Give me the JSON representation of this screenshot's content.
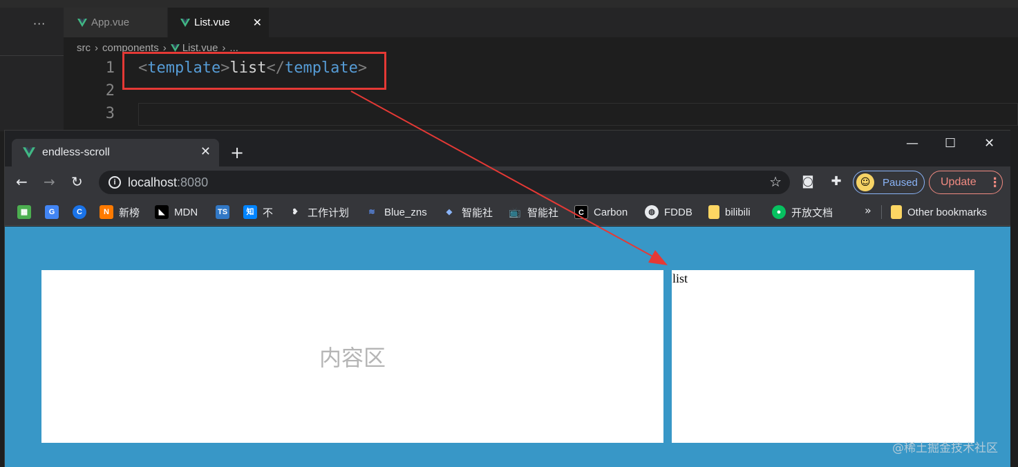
{
  "editor": {
    "more_icon": "ellipsis-icon",
    "tabs": [
      {
        "label": "App.vue",
        "icon": "vue-logo-icon",
        "active": false
      },
      {
        "label": "List.vue",
        "icon": "vue-logo-icon",
        "active": true
      }
    ],
    "close_glyph": "✕",
    "breadcrumb": [
      "src",
      "components",
      "List.vue",
      "..."
    ],
    "line_numbers": [
      "1",
      "2",
      "3"
    ],
    "code": {
      "open_lt": "<",
      "open_tag": "template",
      "open_gt": ">",
      "text": "list",
      "close_lt": "</",
      "close_tag": "template",
      "close_gt": ">"
    },
    "highlight_color": "#e53935"
  },
  "browser": {
    "tab_title": "endless-scroll",
    "tab_close": "✕",
    "new_tab": "+",
    "window_controls": {
      "minimize": "—",
      "maximize": "☐",
      "close": "✕"
    },
    "url_host": "localhost",
    "url_port": ":8080",
    "profile_label": "Paused",
    "update_label": "Update",
    "bookmarks": [
      {
        "label": "",
        "icon": "apps-grid-icon"
      },
      {
        "label": "",
        "icon": "google-translate-icon"
      },
      {
        "label": "",
        "icon": "c-logo-icon"
      },
      {
        "label": "新榜",
        "icon": "newrank-icon"
      },
      {
        "label": "MDN",
        "icon": "mdn-icon"
      },
      {
        "label": "",
        "icon": "typescript-icon"
      },
      {
        "label": "不",
        "icon": "zhihu-icon"
      },
      {
        "label": "工作计划",
        "icon": "feather-icon"
      },
      {
        "label": "Blue_zns",
        "icon": "layers-icon"
      },
      {
        "label": "智能社",
        "icon": "diamond-icon"
      },
      {
        "label": "智能社",
        "icon": "bilibili-tv-icon"
      },
      {
        "label": "Carbon",
        "icon": "carbon-icon"
      },
      {
        "label": "FDDB",
        "icon": "globe-icon"
      },
      {
        "label": "bilibili",
        "icon": "folder-icon"
      },
      {
        "label": "开放文档",
        "icon": "wechat-icon"
      }
    ],
    "overflow": "»",
    "other_bookmarks": "Other bookmarks"
  },
  "page": {
    "content_label": "内容区",
    "list_text": "list",
    "background": "#3897c7"
  },
  "watermark": "@稀土掘金技术社区",
  "annotation_arrow_color": "#e53935"
}
